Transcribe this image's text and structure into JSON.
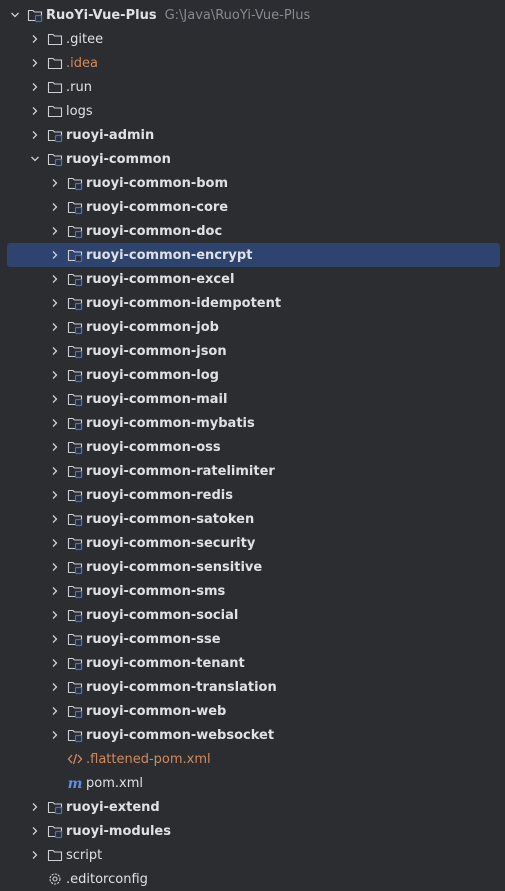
{
  "colors": {
    "background": "#2b2d30",
    "selection": "#2e436e",
    "text": "#dfe1e5",
    "muted": "#868a91",
    "orange": "#d4895c",
    "module_badge": "#3d72d6"
  },
  "project": {
    "name": "RuoYi-Vue-Plus",
    "path": "G:\\Java\\RuoYi-Vue-Plus"
  },
  "top_items": [
    {
      "label": ".gitee",
      "icon": "folder-icon"
    },
    {
      "label": ".idea",
      "icon": "folder-icon"
    },
    {
      "label": ".run",
      "icon": "folder-icon"
    },
    {
      "label": "logs",
      "icon": "folder-icon"
    },
    {
      "label": "ruoyi-admin",
      "icon": "module-folder-icon"
    },
    {
      "label": "ruoyi-common",
      "icon": "module-folder-icon"
    }
  ],
  "common_children": [
    "ruoyi-common-bom",
    "ruoyi-common-core",
    "ruoyi-common-doc",
    "ruoyi-common-encrypt",
    "ruoyi-common-excel",
    "ruoyi-common-idempotent",
    "ruoyi-common-job",
    "ruoyi-common-json",
    "ruoyi-common-log",
    "ruoyi-common-mail",
    "ruoyi-common-mybatis",
    "ruoyi-common-oss",
    "ruoyi-common-ratelimiter",
    "ruoyi-common-redis",
    "ruoyi-common-satoken",
    "ruoyi-common-security",
    "ruoyi-common-sensitive",
    "ruoyi-common-sms",
    "ruoyi-common-social",
    "ruoyi-common-sse",
    "ruoyi-common-tenant",
    "ruoyi-common-translation",
    "ruoyi-common-web",
    "ruoyi-common-websocket"
  ],
  "common_files": [
    {
      "label": ".flattened-pom.xml",
      "icon": "xml-icon"
    },
    {
      "label": "pom.xml",
      "icon": "maven-icon"
    }
  ],
  "bottom_items": [
    {
      "label": "ruoyi-extend",
      "icon": "module-folder-icon"
    },
    {
      "label": "ruoyi-modules",
      "icon": "module-folder-icon"
    },
    {
      "label": "script",
      "icon": "folder-icon"
    },
    {
      "label": ".editorconfig",
      "icon": "gear-icon"
    }
  ],
  "selected": "ruoyi-common-encrypt"
}
